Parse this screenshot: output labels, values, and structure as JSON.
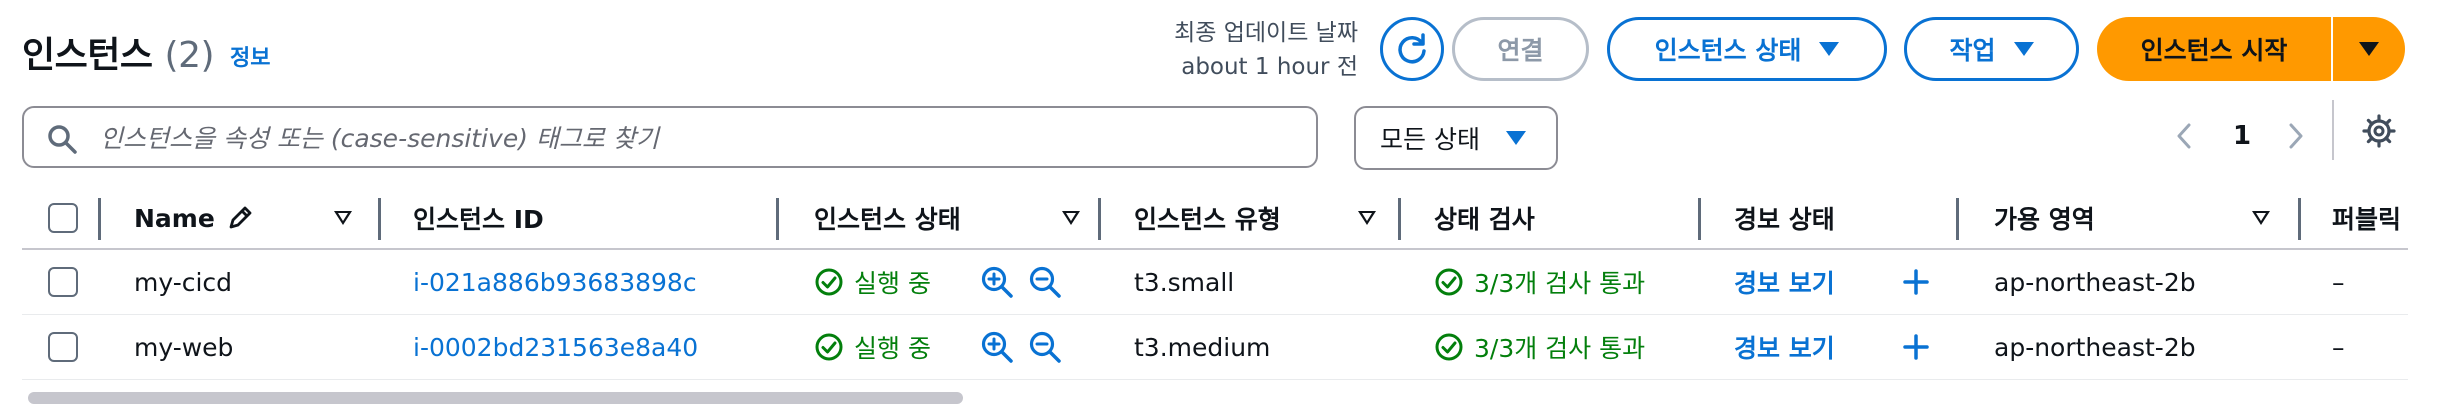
{
  "header": {
    "title": "인스턴스",
    "count": "(2)",
    "info_link": "정보",
    "last_updated_label": "최종 업데이트 날짜",
    "last_updated_value": "about 1 hour 전",
    "refresh_icon": "refresh-icon",
    "buttons": {
      "connect": "연결",
      "instance_state": "인스턴스 상태",
      "actions": "작업",
      "launch": "인스턴스 시작"
    }
  },
  "filter": {
    "search_placeholder": "인스턴스을 속성 또는 (case-sensitive) 태그로 찾기",
    "search_value": "",
    "status_select": "모든 상태"
  },
  "pagination": {
    "current_page": "1"
  },
  "table": {
    "columns": [
      "Name",
      "인스턴스 ID",
      "인스턴스 상태",
      "인스턴스 유형",
      "상태 검사",
      "경보 상태",
      "가용 영역",
      "퍼블릭"
    ],
    "rows": [
      {
        "name": "my-cicd",
        "instance_id": "i-021a886b93683898c",
        "state": "실행 중",
        "type": "t3.small",
        "status_check": "3/3개 검사 통과",
        "alarm": "경보 보기",
        "az": "ap-northeast-2b",
        "public": "–"
      },
      {
        "name": "my-web",
        "instance_id": "i-0002bd231563e8a40",
        "state": "실행 중",
        "type": "t3.medium",
        "status_check": "3/3개 검사 통과",
        "alarm": "경보 보기",
        "az": "ap-northeast-2b",
        "public": "–"
      }
    ]
  },
  "colors": {
    "accent": "#0972d3",
    "primary_button": "#ff9900",
    "success": "#037f0c",
    "text": "#0f141a"
  },
  "scroll": {
    "horizontal_position": 0
  }
}
